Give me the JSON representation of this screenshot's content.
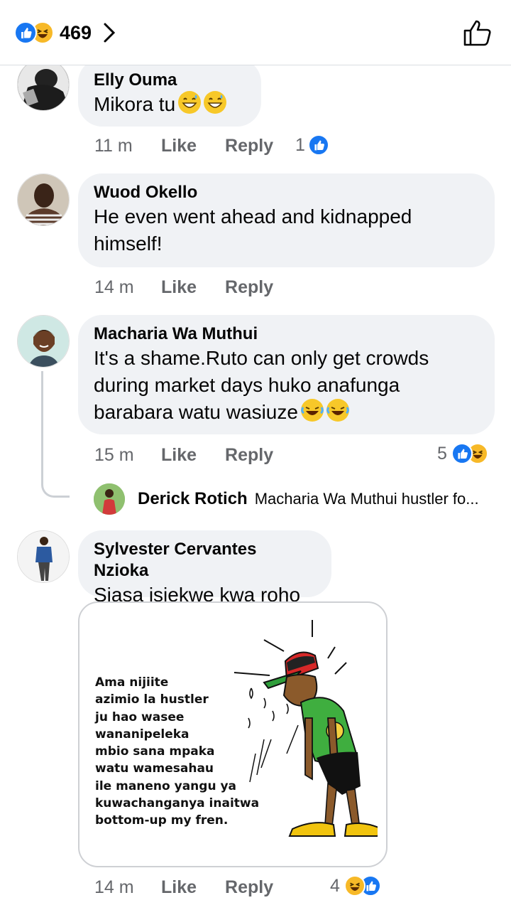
{
  "header": {
    "reaction_count": "469",
    "reaction_icons": [
      "like-icon",
      "haha-icon"
    ]
  },
  "comments": [
    {
      "name": "Elly Ouma",
      "text": "Mikora tu",
      "emojis": [
        "grinning-sweat-emoji",
        "grinning-sweat-emoji"
      ],
      "time": "11 m",
      "like_label": "Like",
      "reply_label": "Reply",
      "reaction_count": "1"
    },
    {
      "name": "Wuod Okello",
      "text": "He even went ahead and kidnapped himself!",
      "time": "14 m",
      "like_label": "Like",
      "reply_label": "Reply"
    },
    {
      "name": "Macharia Wa Muthui",
      "text": "It's a shame.Ruto can only get crowds during market days huko anafunga barabara watu wasiuze",
      "emojis": [
        "tears-of-joy-emoji",
        "tears-of-joy-emoji"
      ],
      "time": "15 m",
      "like_label": "Like",
      "reply_label": "Reply",
      "reaction_count": "5",
      "reply_preview": {
        "name": "Derick Rotich",
        "snippet": "Macharia Wa Muthui hustler fo..."
      }
    },
    {
      "name": "Sylvester Cervantes Nzioka",
      "text": "Siasa isiekwe kwa roho",
      "image_text": "Ama nijiite\nazimio la hustler\nju hao wasee\nwananipeleka\nmbio sana mpaka\nwatu wamesahau\nile maneno yangu ya\nkuwachanganya inaitwa\nbottom-up my fren.",
      "time": "14 m",
      "like_label": "Like",
      "reply_label": "Reply",
      "reaction_count": "4"
    }
  ],
  "colors": {
    "facebook_blue": "#1877f2",
    "bubble_bg": "#f0f2f5",
    "meta_text": "#65676b",
    "haha_yellow": "#f7b928"
  }
}
